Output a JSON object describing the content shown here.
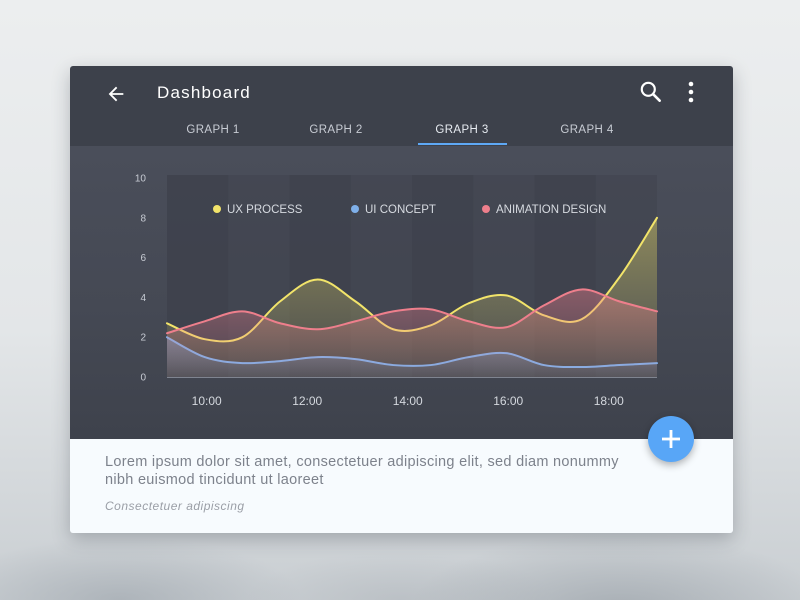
{
  "app": {
    "title": "Dashboard",
    "icons": {
      "back": "arrow-back-icon",
      "search": "search-icon",
      "more": "more-vertical-icon",
      "fab": "plus-icon"
    },
    "colors": {
      "appbar": "#3d414b",
      "accent": "#5ea8f5",
      "fab": "#58a6f7"
    }
  },
  "tabs": [
    {
      "label": "GRAPH 1",
      "active": false
    },
    {
      "label": "GRAPH 2",
      "active": false
    },
    {
      "label": "GRAPH 3",
      "active": true
    },
    {
      "label": "GRAPH 4",
      "active": false
    }
  ],
  "chart_data": {
    "type": "area",
    "x": [
      "09:15",
      "10:00",
      "10:45",
      "11:30",
      "12:15",
      "13:00",
      "13:45",
      "14:30",
      "15:15",
      "16:00",
      "16:45",
      "17:30",
      "18:15",
      "19:00"
    ],
    "x_ticks": [
      "10:00",
      "12:00",
      "14:00",
      "16:00",
      "18:00"
    ],
    "ylim": [
      0,
      10
    ],
    "y_ticks": [
      "0",
      "2",
      "4",
      "6",
      "8",
      "10"
    ],
    "grid": false,
    "legend": "top",
    "series": [
      {
        "name": "UX PROCESS",
        "color": "#f2e46a",
        "values": [
          2.7,
          1.9,
          2.0,
          3.8,
          4.9,
          3.8,
          2.4,
          2.6,
          3.7,
          4.1,
          3.1,
          2.9,
          5.0,
          8.0
        ]
      },
      {
        "name": "UI CONCEPT",
        "color": "#7fb0ea",
        "values": [
          2.0,
          1.0,
          0.7,
          0.8,
          1.0,
          0.9,
          0.6,
          0.6,
          1.0,
          1.2,
          0.6,
          0.5,
          0.6,
          0.7
        ]
      },
      {
        "name": "ANIMATION DESIGN",
        "color": "#ee7f8c",
        "values": [
          2.2,
          2.8,
          3.3,
          2.7,
          2.4,
          2.8,
          3.3,
          3.4,
          2.8,
          2.5,
          3.6,
          4.4,
          3.8,
          3.3
        ]
      }
    ]
  },
  "footer": {
    "text": "Lorem ipsum dolor sit amet, consectetuer adipiscing elit, sed diam nonummy nibh euismod tincidunt ut laoreet",
    "subtext": "Consectetuer adipiscing"
  }
}
